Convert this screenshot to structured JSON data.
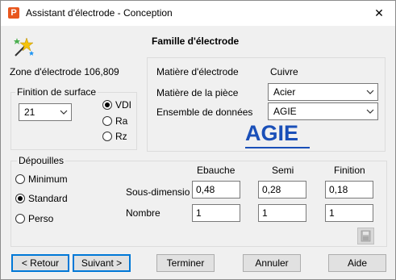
{
  "window": {
    "title": "Assistant d'électrode - Conception",
    "close_symbol": "✕"
  },
  "header": {
    "heading": "Famille d'électrode"
  },
  "zone": {
    "label": "Zone d'électrode 106,809"
  },
  "finish": {
    "group_title": "Finition de surface",
    "value": "21",
    "options": [
      "VDI",
      "Ra",
      "Rz"
    ],
    "selected": "VDI"
  },
  "materials": {
    "electrode_label": "Matière d'électrode",
    "electrode_value": "Cuivre",
    "part_label": "Matière de la pièce",
    "part_value": "Acier",
    "dataset_label": "Ensemble de données",
    "dataset_value": "AGIE",
    "brand": "AGIE"
  },
  "drafts": {
    "group_title": "Dépouilles",
    "options": [
      "Minimum",
      "Standard",
      "Perso"
    ],
    "selected": "Standard",
    "columns": [
      "Ebauche",
      "Semi",
      "Finition"
    ],
    "rows": [
      {
        "label": "Sous-dimensio",
        "values": [
          "0,48",
          "0,28",
          "0,18"
        ]
      },
      {
        "label": "Nombre",
        "values": [
          "1",
          "1",
          "1"
        ]
      }
    ]
  },
  "buttons": {
    "back": "< Retour",
    "next": "Suivant >",
    "finish": "Terminer",
    "cancel": "Annuler",
    "help": "Aide"
  }
}
